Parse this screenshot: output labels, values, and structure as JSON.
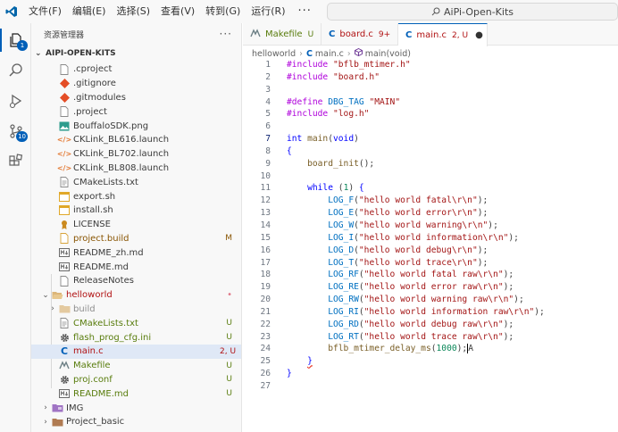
{
  "titlebar": {
    "menu": [
      "文件(F)",
      "编辑(E)",
      "选择(S)",
      "查看(V)",
      "转到(G)",
      "运行(R)"
    ],
    "more": "···",
    "search_text": "AiPi-Open-Kits"
  },
  "activity": {
    "explorer_badge": "1",
    "scm_badge": "10"
  },
  "sidebar": {
    "header": "资源管理器",
    "more": "···",
    "root": "AIPI-OPEN-KITS",
    "rows": [
      {
        "name": ".cproject",
        "status": ""
      },
      {
        "name": ".gitignore",
        "status": ""
      },
      {
        "name": ".gitmodules",
        "status": ""
      },
      {
        "name": ".project",
        "status": ""
      },
      {
        "name": "BouffaloSDK.png",
        "status": ""
      },
      {
        "name": "CKLink_BL616.launch",
        "status": ""
      },
      {
        "name": "CKLink_BL702.launch",
        "status": ""
      },
      {
        "name": "CKLink_BL808.launch",
        "status": ""
      },
      {
        "name": "CMakeLists.txt",
        "status": ""
      },
      {
        "name": "export.sh",
        "status": ""
      },
      {
        "name": "install.sh",
        "status": ""
      },
      {
        "name": "LICENSE",
        "status": ""
      },
      {
        "name": "project.build",
        "status": "M"
      },
      {
        "name": "README_zh.md",
        "status": ""
      },
      {
        "name": "README.md",
        "status": ""
      },
      {
        "name": "ReleaseNotes",
        "status": ""
      },
      {
        "name": "helloworld",
        "status": "•"
      },
      {
        "name": "build",
        "status": ""
      },
      {
        "name": "CMakeLists.txt",
        "status": "U"
      },
      {
        "name": "flash_prog_cfg.ini",
        "status": "U"
      },
      {
        "name": "main.c",
        "status": "2, U"
      },
      {
        "name": "Makefile",
        "status": "U"
      },
      {
        "name": "proj.conf",
        "status": "U"
      },
      {
        "name": "README.md",
        "status": "U"
      },
      {
        "name": "IMG",
        "status": ""
      },
      {
        "name": "Project_basic",
        "status": ""
      }
    ]
  },
  "tabs": [
    {
      "label": "Makefile",
      "status": "U"
    },
    {
      "label": "board.c",
      "status": "9+"
    },
    {
      "label": "main.c",
      "status": "2, U",
      "dirty": "●"
    }
  ],
  "breadcrumb": {
    "folder": "helloworld",
    "file": "main.c",
    "symbol": "main(void)"
  },
  "editor": {
    "line_numbers": [
      "1",
      "2",
      "3",
      "4",
      "5",
      "6",
      "7",
      "8",
      "9",
      "10",
      "11",
      "12",
      "13",
      "14",
      "15",
      "16",
      "17",
      "18",
      "19",
      "20",
      "21",
      "22",
      "23",
      "24",
      "25",
      "26",
      "27"
    ]
  }
}
